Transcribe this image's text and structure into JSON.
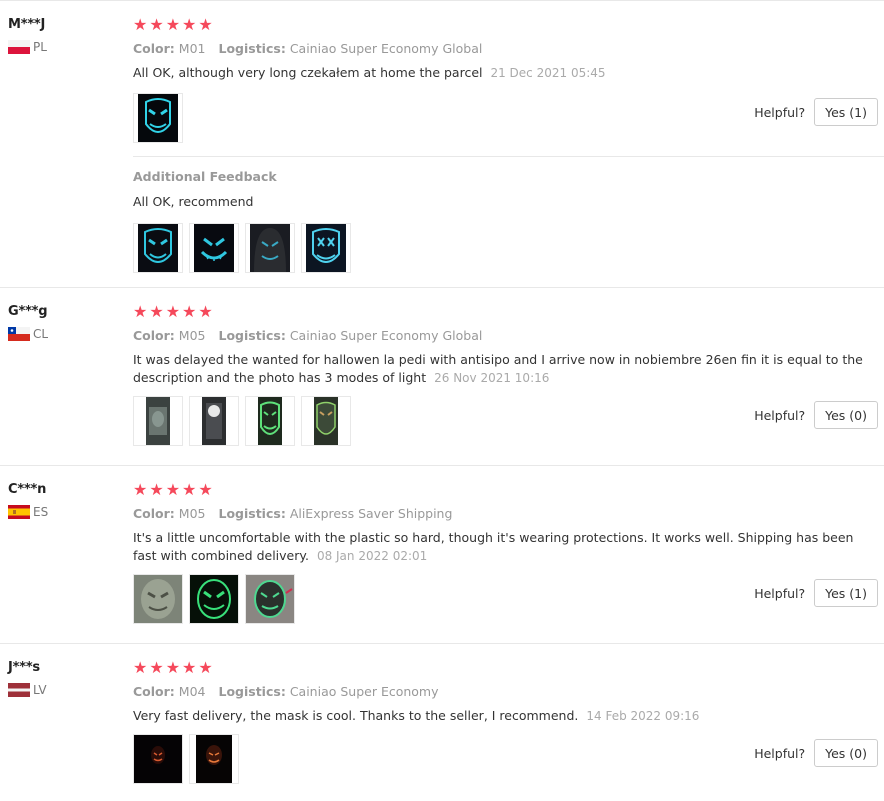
{
  "labels": {
    "color": "Color:",
    "logistics": "Logistics:",
    "helpful": "Helpful?",
    "additional_feedback": "Additional Feedback"
  },
  "colors": {
    "star": "#f5495b",
    "muted": "#999999"
  },
  "reviews": [
    {
      "user": "M***J",
      "country": "PL",
      "flag": "poland-flag-icon",
      "stars": 5,
      "color": "M01",
      "logistics": "Cainiao Super Economy Global",
      "text": "All OK, although very long czekałem at home the parcel",
      "date": "21 Dec 2021 05:45",
      "images": [
        "mask-photo-blue-grin"
      ],
      "helpful_button": "Yes (1)",
      "additional": {
        "text": "All OK, recommend",
        "images": [
          "mask-photo-blue-1",
          "mask-photo-blue-2",
          "mask-photo-hood",
          "mask-photo-blue-x"
        ]
      }
    },
    {
      "user": "G***g",
      "country": "CL",
      "flag": "chile-flag-icon",
      "stars": 5,
      "color": "M05",
      "logistics": "Cainiao Super Economy Global",
      "text": "It was delayed the wanted for hallowen la pedi with antisipo and I arrive now in nobiembre 26en fin it is equal to the description and the photo has 3 modes of light",
      "date": "26 Nov 2021 10:16",
      "images": [
        "mask-photo-mirror-1",
        "mask-photo-mirror-2",
        "mask-photo-green-1",
        "mask-photo-green-2"
      ],
      "helpful_button": "Yes (0)"
    },
    {
      "user": "C***n",
      "country": "ES",
      "flag": "spain-flag-icon",
      "stars": 5,
      "color": "M05",
      "logistics": "AliExpress Saver Shipping",
      "text": "It's a little uncomfortable with the plastic so hard, though it's wearing protections. It works well. Shipping has been fast with combined delivery.",
      "date": "08 Jan 2022 02:01",
      "images": [
        "mask-photo-packaged",
        "mask-photo-green-glow",
        "mask-photo-green-lit"
      ],
      "helpful_button": "Yes (1)"
    },
    {
      "user": "J***s",
      "country": "LV",
      "flag": "latvia-flag-icon",
      "stars": 5,
      "color": "M04",
      "logistics": "Cainiao Super Economy",
      "text": "Very fast delivery, the mask is cool. Thanks to the seller, I recommend.",
      "date": "14 Feb 2022 09:16",
      "images": [
        "mask-photo-orange-dark-1",
        "mask-photo-orange-dark-2"
      ],
      "helpful_button": "Yes (0)"
    }
  ]
}
